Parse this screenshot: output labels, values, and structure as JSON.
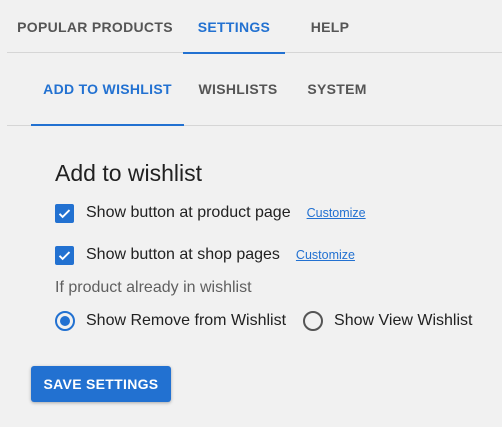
{
  "top_tabs": [
    {
      "label": "POPULAR PRODUCTS",
      "active": false
    },
    {
      "label": "SETTINGS",
      "active": true
    },
    {
      "label": "HELP",
      "active": false
    }
  ],
  "sub_tabs": [
    {
      "label": "ADD TO WISHLIST",
      "active": true
    },
    {
      "label": "WISHLISTS",
      "active": false
    },
    {
      "label": "SYSTEM",
      "active": false
    }
  ],
  "section": {
    "title": "Add to wishlist",
    "options": [
      {
        "label": "Show button at product page",
        "checked": true,
        "customize_label": "Customize"
      },
      {
        "label": "Show button at shop pages",
        "checked": true,
        "customize_label": "Customize"
      }
    ],
    "hint": "If product already in wishlist",
    "radios": [
      {
        "label": "Show Remove from Wishlist",
        "checked": true
      },
      {
        "label": "Show View Wishlist",
        "checked": false
      }
    ]
  },
  "save_button": {
    "label": "SAVE SETTINGS"
  },
  "colors": {
    "accent": "#2271d1",
    "background": "#f1f1f1",
    "text": "#212121",
    "muted": "#555555"
  }
}
